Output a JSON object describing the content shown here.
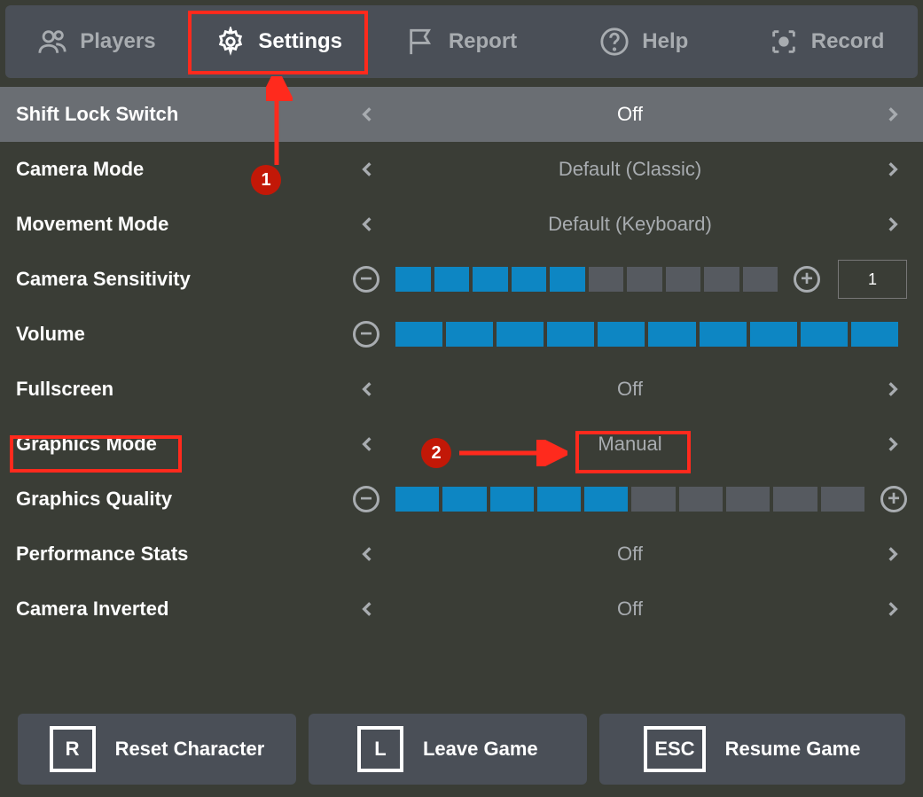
{
  "tabs": {
    "players": "Players",
    "settings": "Settings",
    "report": "Report",
    "help": "Help",
    "record": "Record"
  },
  "settings": {
    "shift_lock": {
      "label": "Shift Lock Switch",
      "value": "Off"
    },
    "camera_mode": {
      "label": "Camera Mode",
      "value": "Default (Classic)"
    },
    "movement_mode": {
      "label": "Movement Mode",
      "value": "Default (Keyboard)"
    },
    "camera_sensitivity": {
      "label": "Camera Sensitivity",
      "segments_on": 5,
      "segments_total": 10,
      "input_value": "1"
    },
    "volume": {
      "label": "Volume",
      "segments_on": 10,
      "segments_total": 10
    },
    "fullscreen": {
      "label": "Fullscreen",
      "value": "Off"
    },
    "graphics_mode": {
      "label": "Graphics Mode",
      "value": "Manual"
    },
    "graphics_quality": {
      "label": "Graphics Quality",
      "segments_on": 5,
      "segments_total": 10
    },
    "performance_stats": {
      "label": "Performance Stats",
      "value": "Off"
    },
    "camera_inverted": {
      "label": "Camera Inverted",
      "value": "Off"
    }
  },
  "footer": {
    "reset": {
      "key": "R",
      "label": "Reset Character"
    },
    "leave": {
      "key": "L",
      "label": "Leave Game"
    },
    "resume": {
      "key": "ESC",
      "label": "Resume Game"
    }
  },
  "annotations": {
    "marker1": "1",
    "marker2": "2"
  }
}
